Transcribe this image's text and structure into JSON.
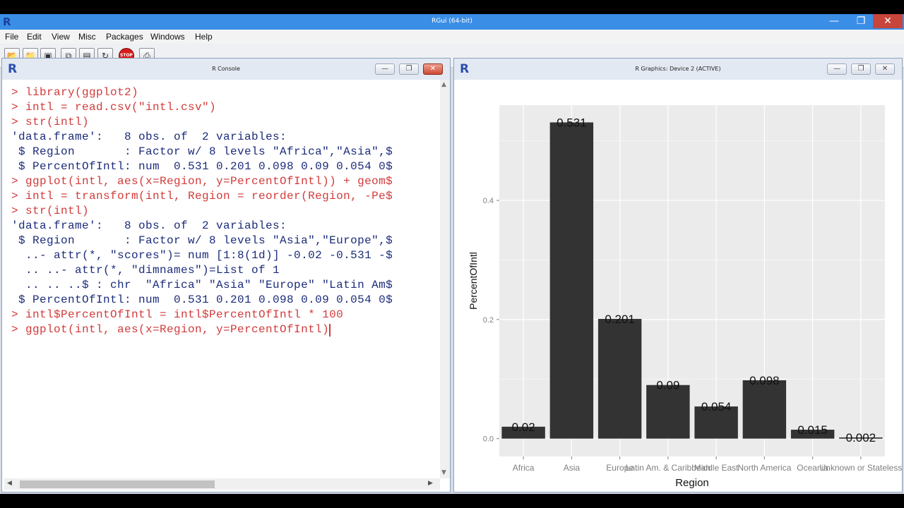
{
  "app": {
    "title": "RGui (64-bit)",
    "logo": "R",
    "menu": [
      "File",
      "Edit",
      "View",
      "Misc",
      "Packages",
      "Windows",
      "Help"
    ],
    "toolbar_icons": [
      "open-script-icon",
      "load-workspace-icon",
      "save-icon",
      "copy-icon",
      "paste-icon",
      "refresh-icon",
      "stop-icon",
      "print-icon"
    ],
    "stop_label": "STOP"
  },
  "console": {
    "title": "R Console",
    "logo": "R",
    "lines": [
      {
        "kind": "in",
        "text": "> library(ggplot2)"
      },
      {
        "kind": "in",
        "text": "> intl = read.csv(\"intl.csv\")"
      },
      {
        "kind": "in",
        "text": "> str(intl)"
      },
      {
        "kind": "out",
        "text": "'data.frame':   8 obs. of  2 variables:"
      },
      {
        "kind": "out",
        "text": " $ Region       : Factor w/ 8 levels \"Africa\",\"Asia\",$"
      },
      {
        "kind": "out",
        "text": " $ PercentOfIntl: num  0.531 0.201 0.098 0.09 0.054 0$"
      },
      {
        "kind": "in",
        "text": "> ggplot(intl, aes(x=Region, y=PercentOfIntl)) + geom$"
      },
      {
        "kind": "in",
        "text": "> intl = transform(intl, Region = reorder(Region, -Pe$"
      },
      {
        "kind": "in",
        "text": "> str(intl)"
      },
      {
        "kind": "out",
        "text": "'data.frame':   8 obs. of  2 variables:"
      },
      {
        "kind": "out",
        "text": " $ Region       : Factor w/ 8 levels \"Asia\",\"Europe\",$"
      },
      {
        "kind": "out",
        "text": "  ..- attr(*, \"scores\")= num [1:8(1d)] -0.02 -0.531 -$"
      },
      {
        "kind": "out",
        "text": "  .. ..- attr(*, \"dimnames\")=List of 1"
      },
      {
        "kind": "out",
        "text": "  .. .. ..$ : chr  \"Africa\" \"Asia\" \"Europe\" \"Latin Am$"
      },
      {
        "kind": "out",
        "text": " $ PercentOfIntl: num  0.531 0.201 0.098 0.09 0.054 0$"
      },
      {
        "kind": "in",
        "text": "> intl$PercentOfIntl = intl$PercentOfIntl * 100"
      },
      {
        "kind": "in",
        "text": "> ggplot(intl, aes(x=Region, y=PercentOfIntl)"
      }
    ]
  },
  "graphics": {
    "title": "R Graphics: Device 2 (ACTIVE)",
    "logo": "R"
  },
  "chart_data": {
    "type": "bar",
    "categories": [
      "Africa",
      "Asia",
      "Europe",
      "Latin Am. & Caribbean",
      "Middle East",
      "North America",
      "Oceania",
      "Unknown or Stateless"
    ],
    "values": [
      0.02,
      0.531,
      0.201,
      0.09,
      0.054,
      0.098,
      0.015,
      0.002
    ],
    "data_labels": [
      "0.02",
      "0.531",
      "0.201",
      "0.09",
      "0.054",
      "0.098",
      "0.015",
      "0.002"
    ],
    "xlabel": "Region",
    "ylabel": "PercentOfIntl",
    "ylim": [
      -0.03,
      0.56
    ],
    "yticks": [
      0.0,
      0.2,
      0.4
    ],
    "ytick_labels": [
      "0.0",
      "0.2",
      "0.4"
    ],
    "grid": true,
    "colors": {
      "panel": "#ebebeb",
      "grid_major": "#ffffff",
      "grid_minor": "#f5f5f5",
      "bar": "#333333",
      "label": "#111111",
      "axis_text": "#7f7f7f"
    }
  }
}
